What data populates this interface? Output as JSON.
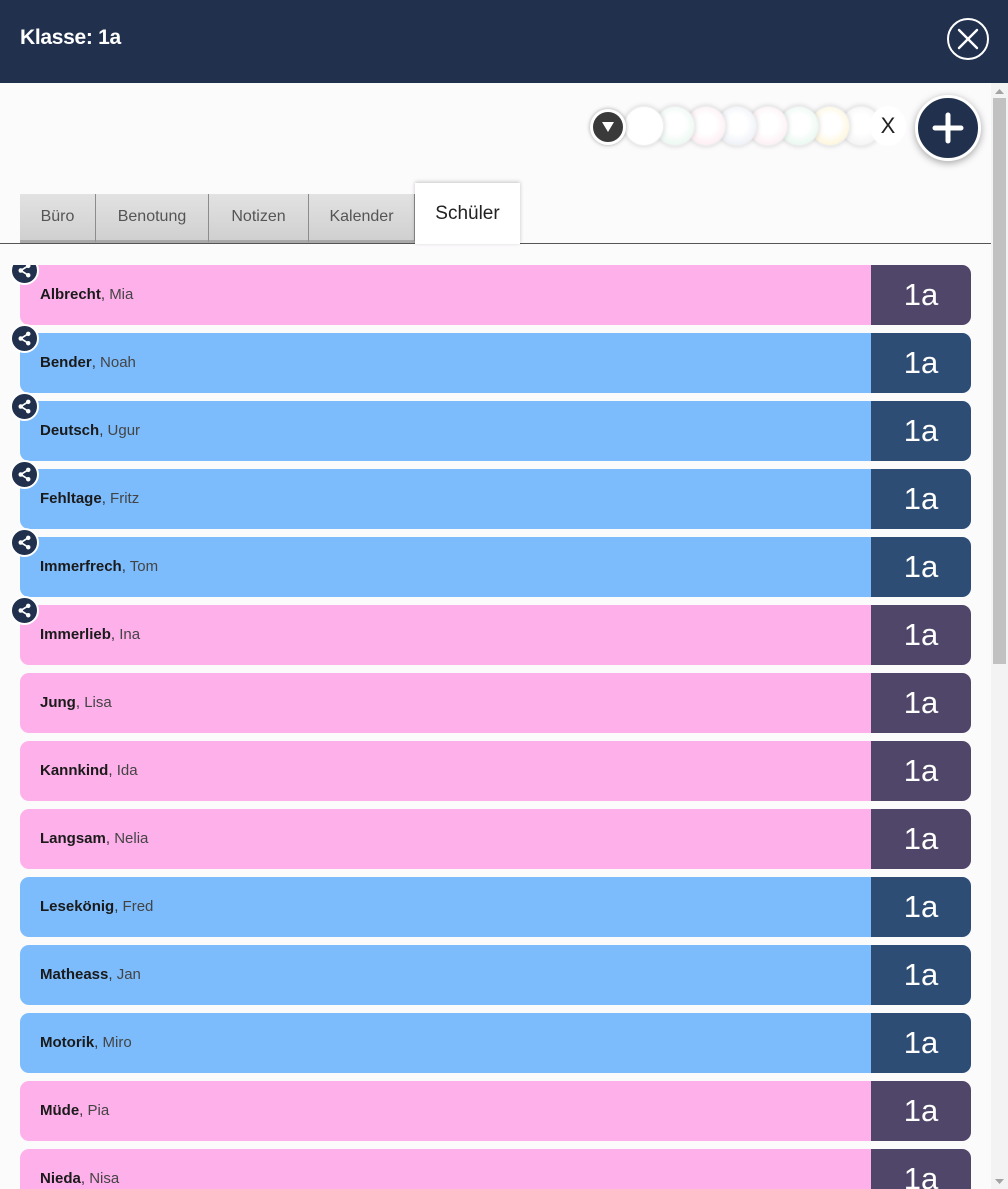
{
  "header": {
    "title": "Klasse: 1a"
  },
  "filter": {
    "clear_label": "X",
    "colors": [
      "#ffffff",
      "#dff5ea",
      "#fde3ec",
      "#e2e8f3",
      "#fbe6ec",
      "#dcf5e8",
      "#fdf0c4",
      "#eeeeee"
    ]
  },
  "tabs": [
    {
      "label": "Büro"
    },
    {
      "label": "Benotung"
    },
    {
      "label": "Notizen"
    },
    {
      "label": "Kalender"
    },
    {
      "label": "Schüler",
      "active": true
    }
  ],
  "students": [
    {
      "last": "Albrecht",
      "first": "Mia",
      "class": "1a",
      "gender": "f",
      "shared": true
    },
    {
      "last": "Bender",
      "first": "Noah",
      "class": "1a",
      "gender": "m",
      "shared": true
    },
    {
      "last": "Deutsch",
      "first": "Ugur",
      "class": "1a",
      "gender": "m",
      "shared": true
    },
    {
      "last": "Fehltage",
      "first": "Fritz",
      "class": "1a",
      "gender": "m",
      "shared": true
    },
    {
      "last": "Immerfrech",
      "first": "Tom",
      "class": "1a",
      "gender": "m",
      "shared": true
    },
    {
      "last": "Immerlieb",
      "first": "Ina",
      "class": "1a",
      "gender": "f",
      "shared": true
    },
    {
      "last": "Jung",
      "first": "Lisa",
      "class": "1a",
      "gender": "f",
      "shared": false
    },
    {
      "last": "Kannkind",
      "first": "Ida",
      "class": "1a",
      "gender": "f",
      "shared": false
    },
    {
      "last": "Langsam",
      "first": "Nelia",
      "class": "1a",
      "gender": "f",
      "shared": false
    },
    {
      "last": "Lesekönig",
      "first": "Fred",
      "class": "1a",
      "gender": "m",
      "shared": false
    },
    {
      "last": "Matheass",
      "first": "Jan",
      "class": "1a",
      "gender": "m",
      "shared": false
    },
    {
      "last": "Motorik",
      "first": "Miro",
      "class": "1a",
      "gender": "m",
      "shared": false
    },
    {
      "last": "Müde",
      "first": "Pia",
      "class": "1a",
      "gender": "f",
      "shared": false
    },
    {
      "last": "Nieda",
      "first": "Nisa",
      "class": "1a",
      "gender": "f",
      "shared": false
    }
  ]
}
